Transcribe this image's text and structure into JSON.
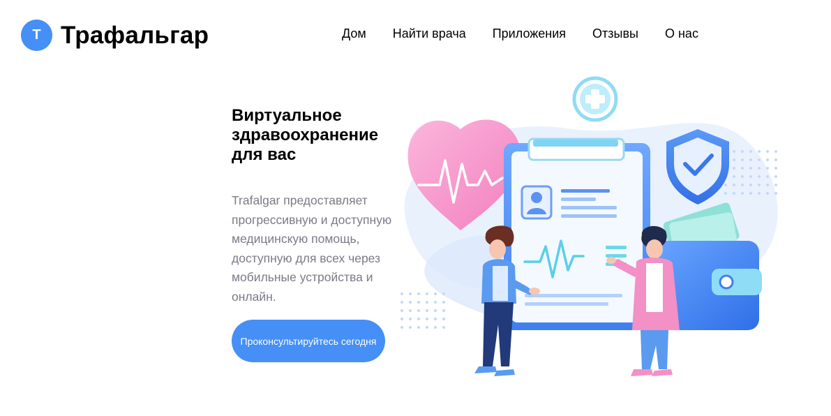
{
  "brand": {
    "logo_letter": "T",
    "name": "Трафальгар"
  },
  "nav": {
    "items": [
      {
        "label": "Дом"
      },
      {
        "label": "Найти врача"
      },
      {
        "label": "Приложения"
      },
      {
        "label": "Отзывы"
      },
      {
        "label": "О нас"
      }
    ]
  },
  "hero": {
    "title": "Виртуальное здравоохранение для вас",
    "description": "Trafalgar предоставляет прогрессивную и доступную медицинскую помощь, доступную для всех через мобильные устройства и онлайн.",
    "cta_label": "Проконсультируйтесь сегодня"
  },
  "colors": {
    "accent": "#458ff6",
    "text_muted": "#7d7987",
    "heart_pink": "#f7a8d3"
  },
  "illustration": {
    "icons": [
      "heart-pulse-icon",
      "medical-cross-icon",
      "shield-check-icon",
      "clipboard-icon",
      "wallet-icon",
      "doctor-figure",
      "patient-figure"
    ]
  }
}
